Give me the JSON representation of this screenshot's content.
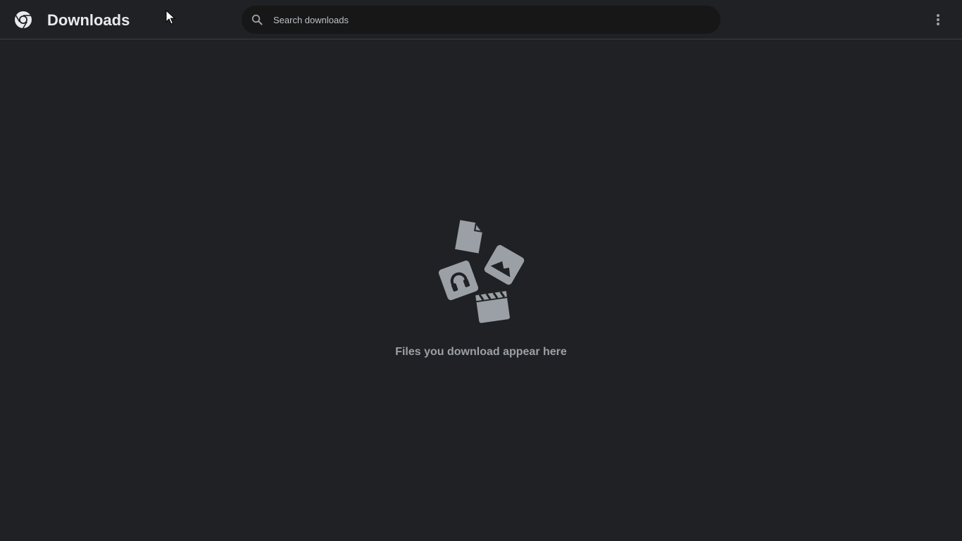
{
  "header": {
    "title": "Downloads",
    "logo_icon": "chrome-logo-icon",
    "more_icon": "more-vert-icon"
  },
  "search": {
    "placeholder": "Search downloads",
    "value": "",
    "icon": "search-icon"
  },
  "empty_state": {
    "message": "Files you download appear here",
    "illustration": "file-types-icon"
  },
  "colors": {
    "background": "#202124",
    "search_background": "#171717",
    "title_text": "#e8eaed",
    "muted_text": "#9aa0a6",
    "illustration": "#9aa0a6"
  }
}
